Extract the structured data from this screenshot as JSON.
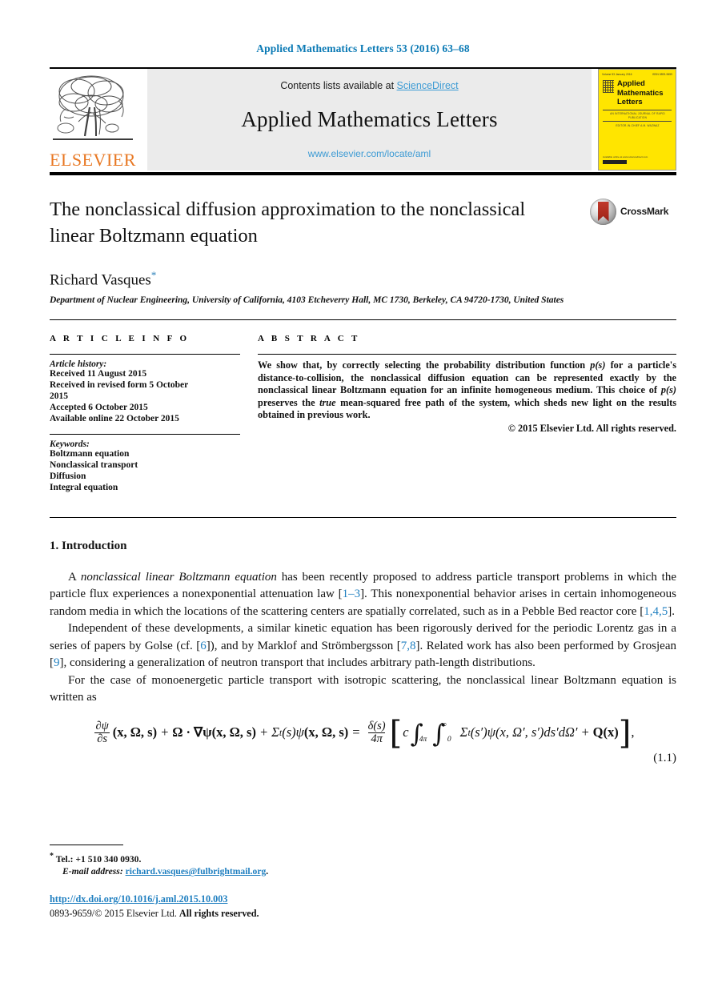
{
  "running_head": "Applied Mathematics Letters 53 (2016) 63–68",
  "masthead": {
    "publisher_logo_text": "ELSEVIER",
    "contents_prefix": "Contents lists available at ",
    "contents_link": "ScienceDirect",
    "journal_name": "Applied Mathematics Letters",
    "journal_url": "www.elsevier.com/locate/aml",
    "cover": {
      "issue_line": "Volume 53  January 2016",
      "issn_corner": "ISSN 0893-9659",
      "title_line1": "Applied",
      "title_line2": "Mathematics",
      "title_line3": "Letters",
      "subtitle": "AN INTERNATIONAL JOURNAL OF RAPID PUBLICATION",
      "editor_line": "EDITOR-IN-CHIEF  A.M. WAZWAZ",
      "footer_note": "Available online at www.sciencedirect.com"
    }
  },
  "article": {
    "title": "The nonclassical diffusion approximation to the nonclassical linear Boltzmann equation",
    "crossmark_label": "CrossMark",
    "author": "Richard Vasques",
    "author_marker": "*",
    "affiliation": "Department of Nuclear Engineering, University of California, 4103 Etcheverry Hall, MC 1730, Berkeley, CA 94720-1730, United States"
  },
  "info": {
    "heading": "A R T I C L E   I N F O",
    "history_label": "Article history:",
    "history": [
      "Received 11 August 2015",
      "Received in revised form 5 October",
      "2015",
      "Accepted 6 October 2015",
      "Available online 22 October 2015"
    ],
    "keywords_label": "Keywords:",
    "keywords": [
      "Boltzmann equation",
      "Nonclassical transport",
      "Diffusion",
      "Integral equation"
    ]
  },
  "abstract": {
    "heading": "A B S T R A C T",
    "paragraph_1": "We show that, by correctly selecting the probability distribution function ",
    "ps_1": "p(s)",
    "paragraph_2": " for a particle's distance-to-collision, the nonclassical diffusion equation can be represented exactly by the nonclassical linear Boltzmann equation for an infinite homogeneous medium. This choice of ",
    "ps_2": "p(s)",
    "paragraph_3": " preserves the ",
    "true_word": "true",
    "paragraph_4": " mean-squared free path of the system, which sheds new light on the results obtained in previous work.",
    "copyright": "© 2015 Elsevier Ltd. All rights reserved."
  },
  "body": {
    "section_number_title": "1. Introduction",
    "p1": {
      "t1": "A ",
      "italic1": "nonclassical linear Boltzmann equation",
      "t2": " has been recently proposed to address particle transport problems in which the particle flux experiences a nonexponential attenuation law [",
      "ref1": "1–3",
      "t3": "]. This nonexponential behavior arises in certain inhomogeneous random media in which the locations of the scattering centers are spatially correlated, such as in a Pebble Bed reactor core [",
      "ref2": "1,4,5",
      "t4": "]."
    },
    "p2": {
      "t1": "Independent of these developments, a similar kinetic equation has been rigorously derived for the periodic Lorentz gas in a series of papers by Golse (cf. [",
      "ref1": "6",
      "t2": "]), and by Marklof and Strömbergsson [",
      "ref2": "7,8",
      "t3": "]. Related work has also been performed by Grosjean [",
      "ref3": "9",
      "t4": "], considering a generalization of neutron transport that includes arbitrary path-length distributions."
    },
    "p3": "For the case of monoenergetic particle transport with isotropic scattering, the nonclassical linear Boltzmann equation is written as",
    "equation": {
      "lhs_frac_num": "∂ψ",
      "lhs_frac_den": "∂s",
      "lhs_args": "(x, Ω, s)",
      "plus1": "+",
      "omega_dot": "Ω · ∇ψ",
      "term2_args": "(x, Ω, s)",
      "plus2": "+",
      "sigma_t": "Σ",
      "sigma_sub": "t",
      "sigma_args": "(s)ψ",
      "term3_args": "(x, Ω, s)",
      "equals": "=",
      "rhs_frac_num": "δ(s)",
      "rhs_frac_den": "4π",
      "bracket_open": "[",
      "c": "c",
      "int1": "∫",
      "int1_sub": "4π",
      "int2": "∫",
      "int2_sub": "0",
      "int2_sup": "∞",
      "integrand": "Σ",
      "integrand_sub": "t",
      "integrand_rest": "(s′)ψ(x, Ω′, s′)ds′dΩ′",
      "plus3": "+",
      "source": "Q(x)",
      "bracket_close": "]",
      "trailing_comma": ",",
      "number": "(1.1)"
    }
  },
  "footnotes": {
    "star": "*",
    "tel": "Tel.: +1 510 340 0930.",
    "email_label": "E-mail address:",
    "email": "richard.vasques@fulbrightmail.org",
    "email_period": "."
  },
  "footer": {
    "doi": "http://dx.doi.org/10.1016/j.aml.2015.10.003",
    "issn_prefix": "0893-9659/© 2015 Elsevier Ltd. ",
    "rights": "All rights reserved."
  },
  "colors": {
    "link_blue": "#1f7fc0",
    "science_direct_blue": "#3d9bd4",
    "elsevier_orange": "#E87722",
    "cover_yellow": "#ffe500",
    "band_grey": "#ebebeb"
  }
}
